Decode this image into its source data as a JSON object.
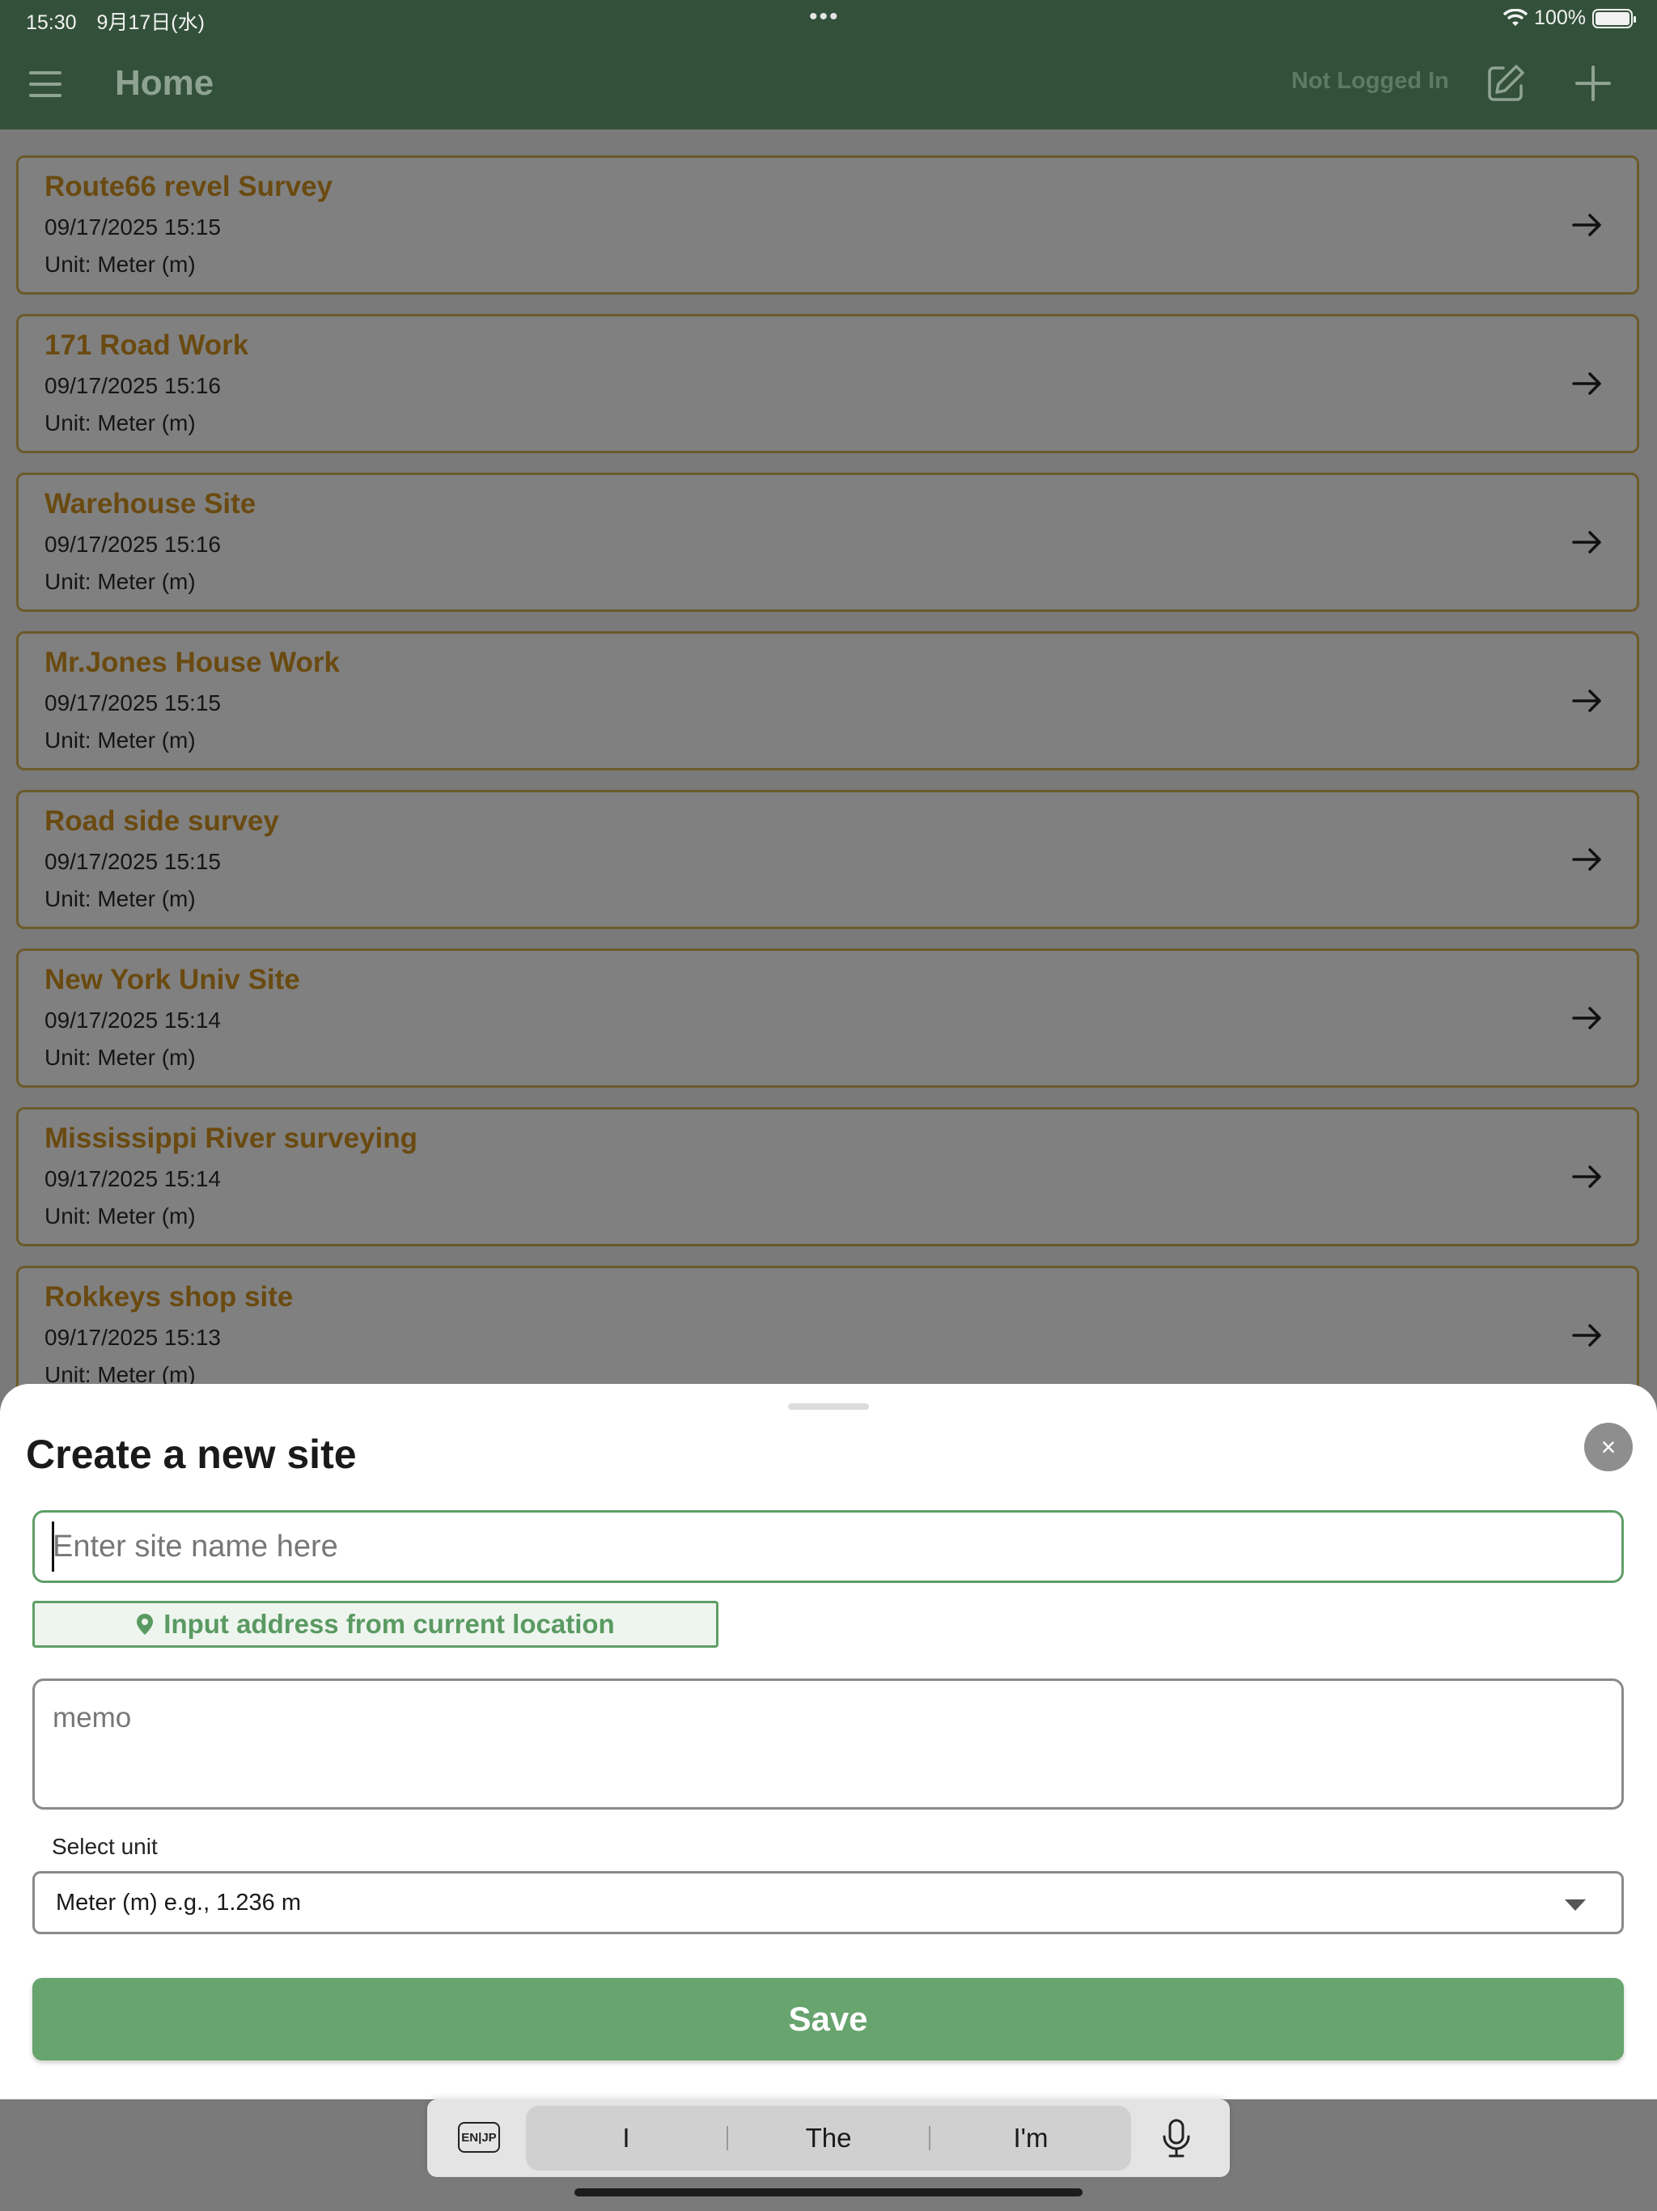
{
  "status_bar": {
    "time": "15:30　9月17日(水)",
    "dots": "•••",
    "battery": "100%"
  },
  "nav": {
    "title": "Home",
    "login_status": "Not Logged In"
  },
  "sites": [
    {
      "name": "Route66 revel Survey",
      "date": "09/17/2025 15:15",
      "unit": "Unit: Meter (m)"
    },
    {
      "name": "171 Road Work",
      "date": "09/17/2025 15:16",
      "unit": "Unit: Meter (m)"
    },
    {
      "name": "Warehouse Site",
      "date": "09/17/2025 15:16",
      "unit": "Unit: Meter (m)"
    },
    {
      "name": "Mr.Jones House Work",
      "date": "09/17/2025 15:15",
      "unit": "Unit: Meter (m)"
    },
    {
      "name": "Road side survey",
      "date": "09/17/2025 15:15",
      "unit": "Unit: Meter (m)"
    },
    {
      "name": "New York Univ Site",
      "date": "09/17/2025 15:14",
      "unit": "Unit: Meter (m)"
    },
    {
      "name": "Mississippi River surveying",
      "date": "09/17/2025 15:14",
      "unit": "Unit: Meter (m)"
    },
    {
      "name": "Rokkeys shop site",
      "date": "09/17/2025 15:13",
      "unit": "Unit: Meter (m)"
    }
  ],
  "sheet": {
    "title": "Create a new site",
    "close_label": "×",
    "name_placeholder": "Enter site name here",
    "name_value": "",
    "location_button": "Input address from current location",
    "memo_placeholder": "memo",
    "memo_value": "",
    "unit_label": "Select unit",
    "unit_selected": "Meter (m) e.g., 1.236 m",
    "save_button": "Save"
  },
  "keyboard": {
    "lang_key": "EN|JP",
    "suggestions": [
      "I",
      "The",
      "I'm"
    ]
  },
  "colors": {
    "nav_bg": "#33513a",
    "accent_green": "#67a46e",
    "site_title": "#6a4a10",
    "overlay_bg": "#808080"
  }
}
